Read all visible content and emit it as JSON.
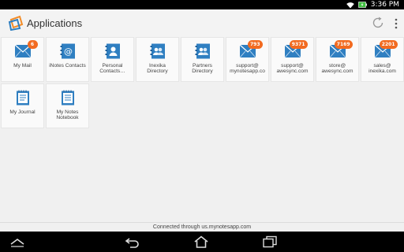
{
  "status_bar": {
    "time": "3:36 PM",
    "icons": [
      "wifi-icon",
      "battery-charging-icon"
    ]
  },
  "header": {
    "title": "Applications",
    "icons": [
      "app-logo-icon",
      "refresh-icon",
      "overflow-menu-icon"
    ]
  },
  "apps": [
    {
      "label": "My Mail",
      "icon": "mail-icon",
      "badge": "6"
    },
    {
      "label": "iNotes Contacts",
      "icon": "contacts-book-icon",
      "badge": ""
    },
    {
      "label": "Personal\nContacts…",
      "icon": "person-contact-icon",
      "badge": ""
    },
    {
      "label": "Inexika\nDirectory",
      "icon": "directory-icon",
      "badge": ""
    },
    {
      "label": "Partners\nDirectory",
      "icon": "directory-icon",
      "badge": ""
    },
    {
      "label": "support@\nmynotesapp.co",
      "icon": "mail-icon",
      "badge": "793"
    },
    {
      "label": "support@\nawesync.com",
      "icon": "mail-icon",
      "badge": "9371"
    },
    {
      "label": "store@\nawesync.com",
      "icon": "mail-icon",
      "badge": "7169"
    },
    {
      "label": "sales@\ninexika.com",
      "icon": "mail-icon",
      "badge": "2201"
    },
    {
      "label": "My Journal",
      "icon": "journal-icon",
      "badge": ""
    },
    {
      "label": "My Notes\nNotebook",
      "icon": "notebook-icon",
      "badge": ""
    }
  ],
  "footer": {
    "text": "Connected through us.mynotesapp.com"
  },
  "nav_bar": {
    "icons": [
      "collapse-icon",
      "back-icon",
      "home-icon",
      "recent-apps-icon"
    ]
  },
  "colors": {
    "accent_blue": "#2f7fc1",
    "badge_orange": "#f26b21"
  }
}
